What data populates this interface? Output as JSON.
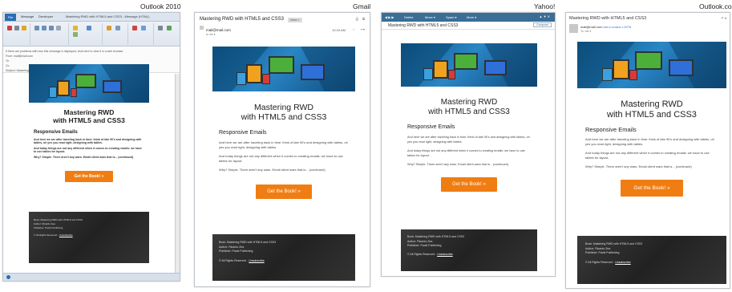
{
  "labels": {
    "outlook2010": "Outlook 2010",
    "gmail": "Gmail",
    "yahoo": "Yahoo!",
    "outlookcom": "Outlook.com"
  },
  "outlook2010": {
    "window_title": "Mastering RWD with HTML5 and CSS3 - Message (HTML)",
    "file_tab": "File",
    "tabs": [
      "Message",
      "Developer"
    ],
    "info_line": "If there are problems with how this message is displayed, click here to view it in a web browser.",
    "from_label": "From:",
    "from_value": "mail@mail.com",
    "to_label": "To:",
    "cc_label": "Cc:",
    "subject_label": "Subject:",
    "subject_value": "Mastering RWD with HTML5 and CSS3"
  },
  "gmail": {
    "subject": "Mastering RWD with HTML5 and CSS3",
    "inbox_badge": "Inbox ×",
    "from": "mail@mail.com",
    "to": "to me ▾",
    "time": "10:16 AM"
  },
  "yahoo": {
    "subject": "Mastering RWD with HTML5 and CSS3",
    "toolbar": [
      "Delete",
      "Move ▾",
      "Spam ▾",
      "More ▾"
    ],
    "action": "Compose"
  },
  "outlookcom": {
    "subject": "Mastering RWD with HTML5 and CSS3",
    "from": "mail@mail.com",
    "from_extra": "Add to contacts 1:28 PM",
    "to": "To: me ▾"
  },
  "email": {
    "title_line1": "Mastering RWD",
    "title_line2": "with HTML5 and CSS3",
    "subtitle": "Responsive Emails",
    "para1": "And here we are after traveling back in time: think of late 90's and designing with tables, oh yes you read right, designing with tables.",
    "para2": "And today things are not any different when it comes to creating emails: we have to use tables for layout.",
    "para3": "Why? Simple. There aren't any wars. Email client wars that is... (continued)",
    "button": "Get the Book! »",
    "footer_book": "Book: Mastering RWD with HTML5 and CSS3",
    "footer_author": "Author: Ricardo Zea",
    "footer_publisher": "Publisher: Packt Publishing",
    "footer_rights": "© All Rights Reserved -",
    "footer_unsubscribe": "Unsubscribe"
  },
  "colors": {
    "accent": "#f07d12",
    "hero_blue": "#1d6aa3",
    "footer_dark": "#2b2b2b"
  }
}
